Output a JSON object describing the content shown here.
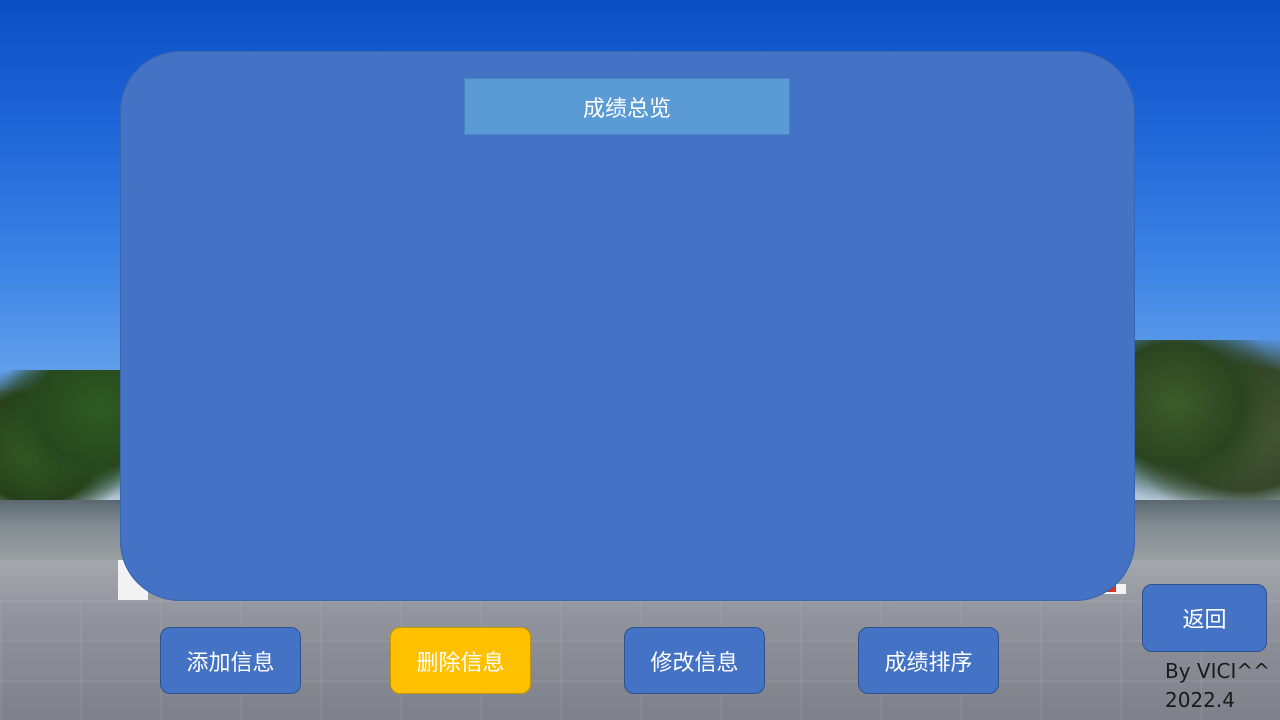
{
  "panel": {
    "title": "成绩总览"
  },
  "buttons": {
    "add": "添加信息",
    "delete": "删除信息",
    "edit": "修改信息",
    "sort": "成绩排序",
    "back": "返回"
  },
  "credit": {
    "author": "By VICI^^",
    "date": "2022.4"
  },
  "colors": {
    "panel": "#4472c4",
    "title_bar": "#5b9bd5",
    "active_button": "#ffc000"
  }
}
